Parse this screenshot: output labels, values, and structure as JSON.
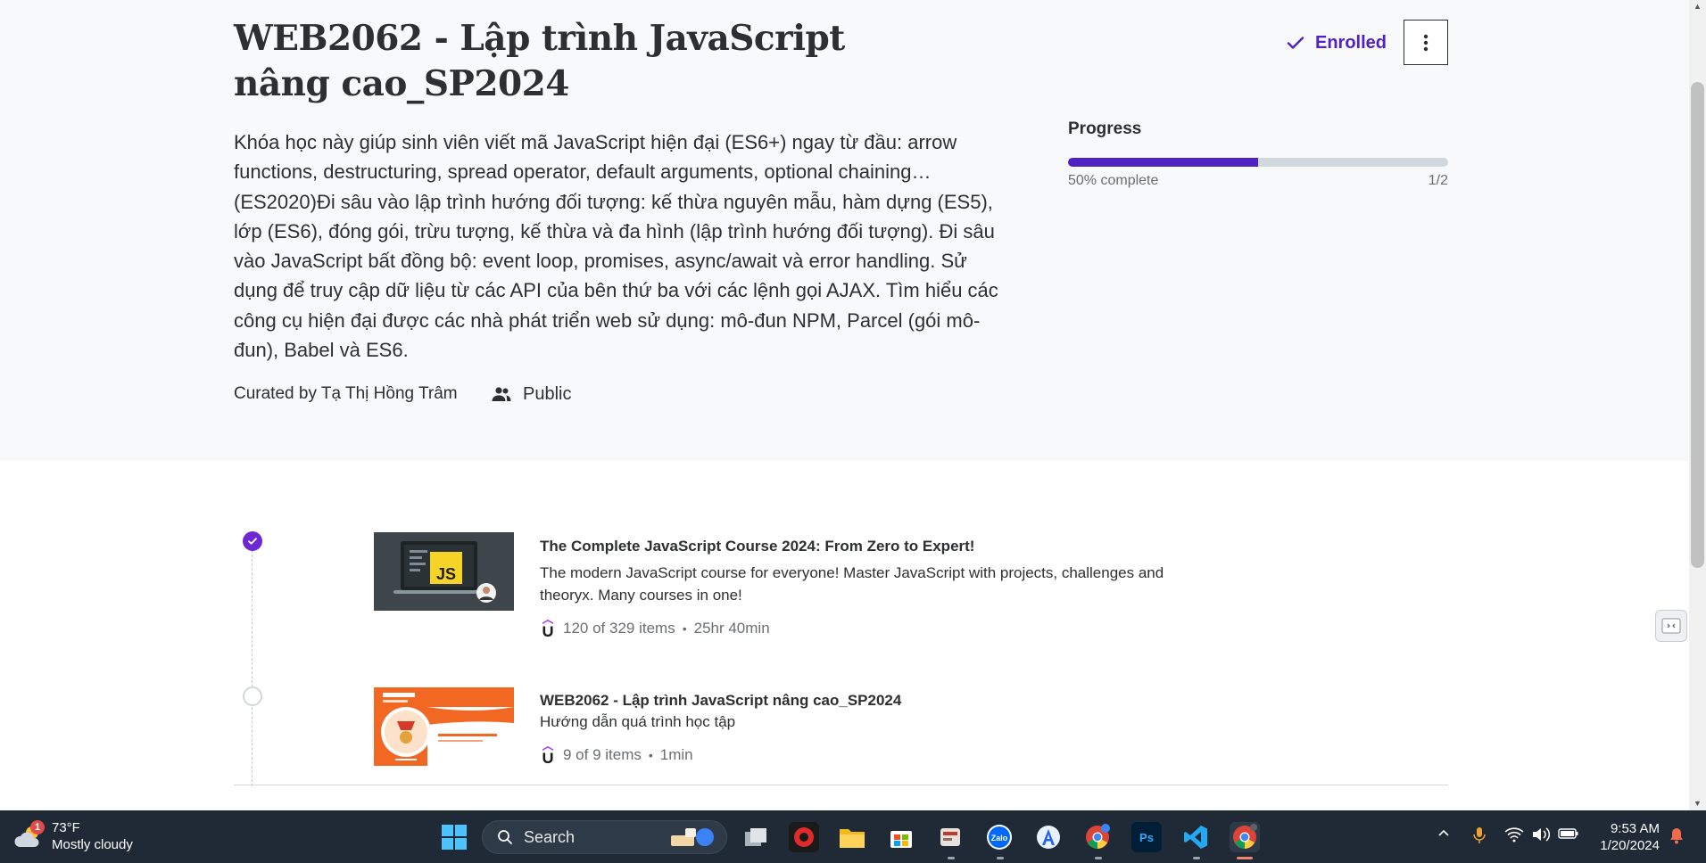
{
  "course": {
    "title": "WEB2062 - Lập trình JavaScript nâng cao_SP2024",
    "enrolled_label": "Enrolled",
    "description": "Khóa học này giúp sinh viên viết mã JavaScript hiện đại (ES6+) ngay từ đầu: arrow functions, destructuring, spread operator, default arguments, optional chaining… (ES2020)Đi sâu vào lập trình hướng đối tượng: kế thừa nguyên mẫu, hàm dựng (ES5), lớp (ES6), đóng gói, trừu tượng, kế thừa và đa hình (lập trình hướng đối tượng). Đi sâu vào JavaScript bất đồng bộ: event loop, promises, async/await và error handling. Sử dụng để truy cập dữ liệu từ các API của bên thứ ba với các lệnh gọi AJAX. Tìm hiểu các công cụ hiện đại được các nhà phát triển web sử dụng: mô-đun NPM, Parcel (gói mô-đun), Babel và ES6.",
    "curated_by": "Curated by Tạ Thị Hồng Trâm",
    "visibility": "Public"
  },
  "progress": {
    "label": "Progress",
    "fraction": 0.5,
    "percent_text": "50% complete",
    "count_text": "1/2"
  },
  "items": [
    {
      "title": "The Complete JavaScript Course 2024: From Zero to Expert!",
      "description": "The modern JavaScript course for everyone! Master JavaScript with projects, challenges and theoryx. Many courses in one!",
      "items_text": "120 of 329 items",
      "duration": "25hr 40min",
      "completed": true,
      "thumb_badge": "JS"
    },
    {
      "title": "WEB2062 - Lập trình JavaScript nâng cao_SP2024",
      "description": "Hướng dẫn quá trình học tập",
      "items_text": "9 of 9 items",
      "duration": "1min",
      "completed": false
    }
  ],
  "taskbar": {
    "weather_temp": "73°F",
    "weather_desc": "Mostly cloudy",
    "weather_badge": "1",
    "search_placeholder": "Search",
    "time": "9:53 AM",
    "date": "1/20/2024",
    "apps": [
      "windows-start",
      "task-view",
      "garena",
      "file-explorer",
      "microsoft-store",
      "app-generic",
      "zalo",
      "app-a",
      "chrome",
      "photoshop",
      "vscode",
      "chrome-profile-d"
    ]
  },
  "colors": {
    "accent": "#5022c3",
    "done_circle": "#6d28d2",
    "hero_bg": "#f7f9fa",
    "taskbar_bg": "#1f2a36"
  }
}
